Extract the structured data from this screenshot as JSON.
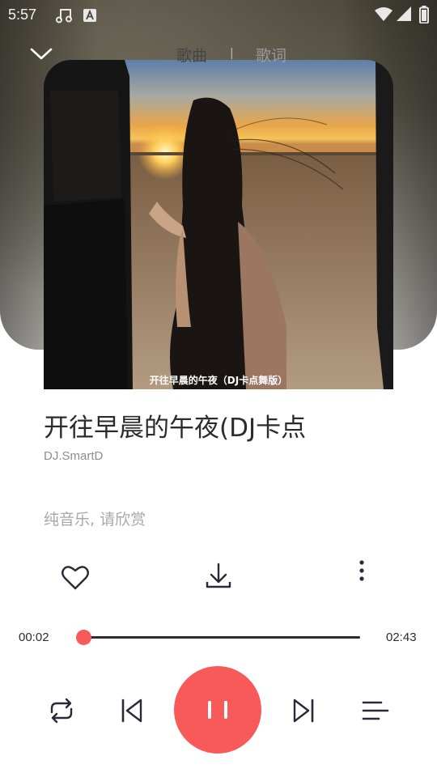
{
  "status_bar": {
    "time": "5:57",
    "icons": [
      "music-note-icon",
      "a-icon",
      "wifi-icon",
      "battery-icon"
    ]
  },
  "header": {
    "collapse_icon": "chevron-down-icon",
    "tabs": [
      {
        "label": "歌曲",
        "active": true
      },
      {
        "label": "歌词",
        "active": false
      }
    ],
    "divider": "|"
  },
  "artwork": {
    "caption": "开往早晨的午夜（DJ卡点舞版）"
  },
  "song": {
    "title": "开往早晨的午夜(DJ卡点",
    "artist": "DJ.SmartD",
    "lyric": "纯音乐, 请欣赏"
  },
  "actions": {
    "like_icon": "heart-icon",
    "download_icon": "download-icon",
    "more_icon": "more-vertical-icon"
  },
  "progress": {
    "current": "00:02",
    "total": "02:43",
    "fraction": 0.012
  },
  "controls": {
    "repeat_icon": "repeat-icon",
    "prev_icon": "skip-previous-icon",
    "play_state": "playing",
    "play_icon": "pause-icon",
    "next_icon": "skip-next-icon",
    "playlist_icon": "playlist-icon"
  },
  "colors": {
    "accent": "#f85a5a",
    "track": "#2b2838",
    "title": "#2b2b2b",
    "muted": "#8d8d8d"
  }
}
